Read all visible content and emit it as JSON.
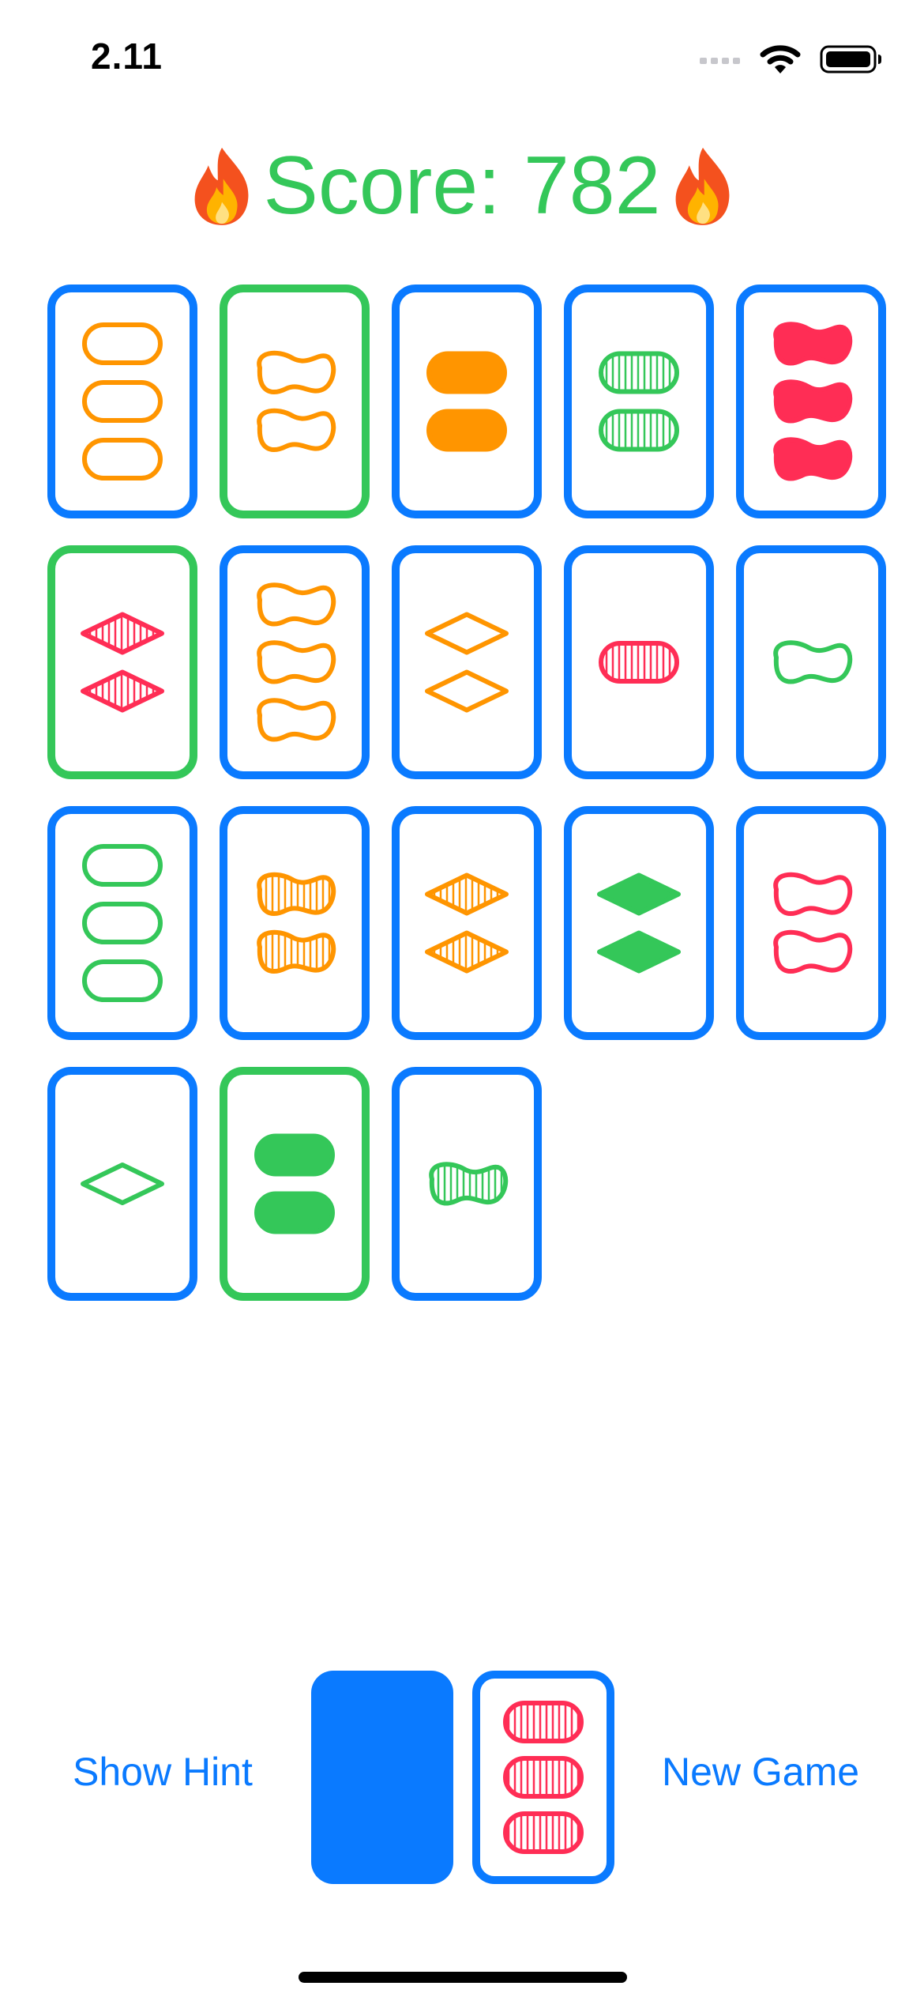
{
  "status_bar": {
    "time": "2.11",
    "icons": [
      "cellular-signal-icon",
      "wifi-icon",
      "battery-icon"
    ]
  },
  "score": {
    "label": "Score: 782",
    "icon": "fire-emoji",
    "color": "#34C759"
  },
  "colors": {
    "accent": "#0A7AFF",
    "selected": "#34C759",
    "card_orange": "#FF9500",
    "card_green": "#34C759",
    "card_red": "#FF2D55"
  },
  "cards": [
    {
      "count": 3,
      "shape": "oval",
      "shading": "open",
      "color": "orange",
      "selected": false
    },
    {
      "count": 2,
      "shape": "squiggle",
      "shading": "open",
      "color": "orange",
      "selected": true
    },
    {
      "count": 2,
      "shape": "oval",
      "shading": "solid",
      "color": "orange",
      "selected": false
    },
    {
      "count": 2,
      "shape": "oval",
      "shading": "striped",
      "color": "green",
      "selected": false
    },
    {
      "count": 3,
      "shape": "squiggle",
      "shading": "solid",
      "color": "red",
      "selected": false
    },
    {
      "count": 2,
      "shape": "diamond",
      "shading": "striped",
      "color": "red",
      "selected": true
    },
    {
      "count": 3,
      "shape": "squiggle",
      "shading": "open",
      "color": "orange",
      "selected": false
    },
    {
      "count": 2,
      "shape": "diamond",
      "shading": "open",
      "color": "orange",
      "selected": false
    },
    {
      "count": 1,
      "shape": "oval",
      "shading": "striped",
      "color": "red",
      "selected": false
    },
    {
      "count": 1,
      "shape": "squiggle",
      "shading": "open",
      "color": "green",
      "selected": false
    },
    {
      "count": 3,
      "shape": "oval",
      "shading": "open",
      "color": "green",
      "selected": false
    },
    {
      "count": 2,
      "shape": "squiggle",
      "shading": "striped",
      "color": "orange",
      "selected": false
    },
    {
      "count": 2,
      "shape": "diamond",
      "shading": "striped",
      "color": "orange",
      "selected": false
    },
    {
      "count": 2,
      "shape": "diamond",
      "shading": "solid",
      "color": "green",
      "selected": false
    },
    {
      "count": 2,
      "shape": "squiggle",
      "shading": "open",
      "color": "red",
      "selected": false
    },
    {
      "count": 1,
      "shape": "diamond",
      "shading": "open",
      "color": "green",
      "selected": false
    },
    {
      "count": 2,
      "shape": "oval",
      "shading": "solid",
      "color": "green",
      "selected": true
    },
    {
      "count": 1,
      "shape": "squiggle",
      "shading": "striped",
      "color": "green",
      "selected": false
    }
  ],
  "bottom": {
    "hint_label": "Show Hint",
    "new_game_label": "New Game",
    "discard_card": {
      "count": 3,
      "shape": "oval",
      "shading": "striped",
      "color": "red"
    }
  }
}
